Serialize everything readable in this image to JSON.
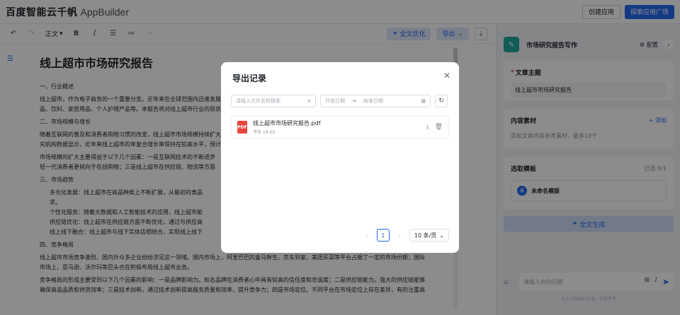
{
  "header": {
    "brand": "百度智能云千帆",
    "product": "AppBuilder",
    "create_app": "创建应用",
    "explore": "探索应用广场"
  },
  "toolbar": {
    "undo_icon": "undo-icon",
    "redo_icon": "redo-icon",
    "text_style": "正文",
    "bold": "B",
    "italic": "I",
    "ai_optimize": "全文优化",
    "export": "导出"
  },
  "document": {
    "title": "线上超市市场研究报告",
    "s1_heading": "一、行业概述",
    "s1_p1": "线上超市，作为电子商务的一个重要分支。近年来在全球范围内迅速发展",
    "s1_p2": "品、饮料、家居用品、个人护理产品等。本报告将对线上超市行业的现状",
    "s2_heading": "二、市场规模与增长",
    "s2_p1": "随着互联网的普及和消费者购物习惯的改变，线上超市市场规模持续扩大",
    "s2_p2": "究机构数据显示，近年来线上超市的年复合增长率保持在较高水平，预计",
    "s2_p3": "市场规模的扩大主要得益于以下几个因素：一是互联网技术的不断进步",
    "s2_p4": "轻一代消费者更倾向于在线购物；三是线上超市在供应链、物流等方面",
    "s3_heading": "三、市场趋势",
    "trends": [
      "多元化发展：线上超市在商品种类上不断扩展，从最初的食品",
      "求。",
      "个性化服务：随着大数据和人工智能技术的应用，线上超市能",
      "供应链优化：线上超市在供应链方面不断优化，通过与供应商",
      "线上线下融合：线上超市与线下实体店相结合，实现线上线下"
    ],
    "s4_heading": "四、竞争格局",
    "s4_p1": "线上超市市场竞争激烈，国内外众多企业纷纷涉足这一领域。国内市场上，阿里巴巴的盒马鲜生、京东到家、美团买菜等平台占据了一定的市场份额；国际",
    "s4_p2": "市场上，亚马逊、沃尔玛等巨头也在积极布局线上超市业务。",
    "s4_p3": "竞争格局的形成主要受到以下几个因素的影响：一是品牌影响力。知名品牌在消费者心中具有较高的信任度和忠诚度；二是供应链能力。强大的供应链能够",
    "s4_p4": "确保商品品质和供货效率；三是技术创新。通过技术创新提高服务质量和效率，提升竞争力；四是市场定位。不同平台在市场定位上存在差异，有的注重高"
  },
  "right_panel": {
    "title": "市场研究报告写作",
    "config": "配置",
    "topic_label": "文章主题",
    "topic_value": "线上超市市场研究报告",
    "material_label": "内容素材",
    "material_add": "+ 添加",
    "material_hint": "添加文章内容参考素材，最多10个",
    "template_label": "选取模板",
    "template_count": "已选 0/1",
    "template_name": "未命名模版",
    "template_avatar": "未",
    "generate": "全文生成",
    "chat_placeholder": "请输入你的问题",
    "chat_note": "以上内容由AI生成，仅供参考"
  },
  "modal": {
    "title": "导出记录",
    "search_placeholder": "请输入文件名称搜索",
    "start_date": "开始日期",
    "end_date": "结束日期",
    "file_name": "线上超市市场研究报告.pdf",
    "file_time": "今天 19:25",
    "file_type": "PDF",
    "page_num": "1",
    "page_size": "10 条/页"
  }
}
